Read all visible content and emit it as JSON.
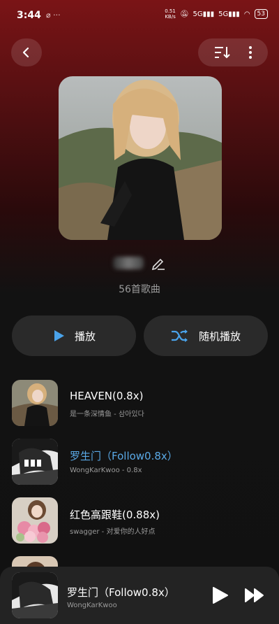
{
  "status": {
    "time": "3:44",
    "speed_top": "0.51",
    "speed_bottom": "KB/s",
    "net1": "5G",
    "net2": "5G",
    "battery": "53"
  },
  "playlist": {
    "count_text": "56首歌曲",
    "play_label": "播放",
    "shuffle_label": "随机播放"
  },
  "accent": "#5aa9e6",
  "songs": [
    {
      "title": "HEAVEN(0.8x)",
      "subtitle": "是一条深情鱼 - 삼아있다",
      "active": false
    },
    {
      "title": "罗生门（Follow0.8x）",
      "subtitle": "WongKarKwoo - 0.8x",
      "active": true
    },
    {
      "title": "红色高跟鞋(0.88x)",
      "subtitle": "swagger - 对爱你的人好点",
      "active": false
    }
  ],
  "now_playing": {
    "title": "罗生门（Follow0.8x）",
    "artist": "WongKarKwoo"
  }
}
